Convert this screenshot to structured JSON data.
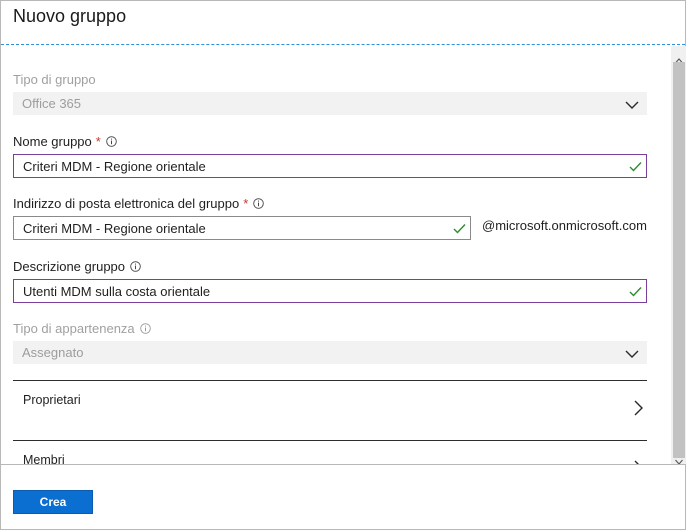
{
  "header": {
    "title": "Nuovo gruppo"
  },
  "form": {
    "group_type": {
      "label": "Tipo di gruppo",
      "value": "Office 365"
    },
    "group_name": {
      "label": "Nome gruppo",
      "required_mark": "*",
      "value": "Criteri MDM - Regione orientale"
    },
    "group_email": {
      "label": "Indirizzo di posta elettronica del gruppo",
      "required_mark": "*",
      "value": "Criteri MDM - Regione orientale",
      "domain_suffix": "@microsoft.onmicrosoft.com"
    },
    "description": {
      "label": "Descrizione gruppo",
      "value": "Utenti MDM sulla costa orientale"
    },
    "membership_type": {
      "label": "Tipo di appartenenza",
      "value": "Assegnato"
    },
    "owners": {
      "label": "Proprietari"
    },
    "members": {
      "label": "Membri"
    }
  },
  "footer": {
    "create_label": "Crea"
  },
  "colors": {
    "accent": "#0b6fd1",
    "focus_border": "#7a3e9d",
    "valid_check": "#2e8b2e",
    "required": "#c0392b"
  }
}
